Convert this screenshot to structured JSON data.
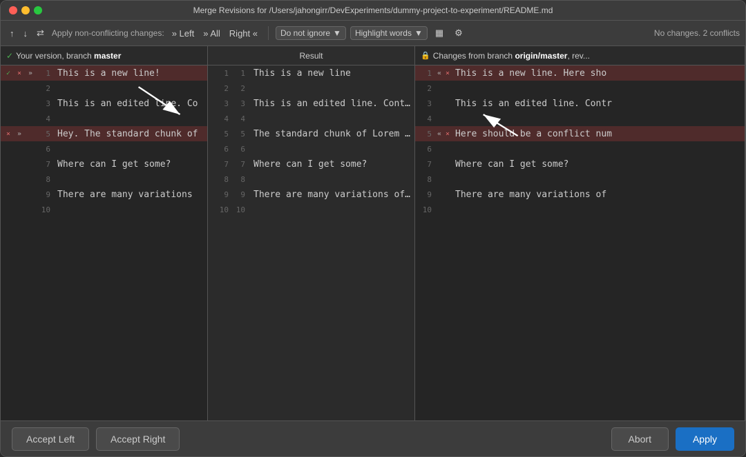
{
  "window": {
    "title": "Merge Revisions for /Users/jahongirr/DevExperiments/dummy-project-to-experiment/README.md"
  },
  "toolbar": {
    "up_icon": "↑",
    "down_icon": "↓",
    "merge_icon": "⇄",
    "apply_non_conflicting": "Apply non-conflicting changes:",
    "left_label": "» Left",
    "all_label": "» All",
    "right_label": "Right «",
    "ignore_dropdown": "Do not ignore",
    "highlight_dropdown": "Highlight words",
    "grid_icon": "▦",
    "settings_icon": "⚙",
    "status": "No changes. 2 conflicts"
  },
  "columns": {
    "left_header": "Your version, branch master",
    "middle_header": "Result",
    "right_header": "Changes from branch origin/master, rev..."
  },
  "left_panel": {
    "lines": [
      {
        "num": 1,
        "conflict": true,
        "accepted": true,
        "content": "This is a new line!",
        "controls": [
          "✓",
          "×",
          "»"
        ]
      },
      {
        "num": 2,
        "conflict": false,
        "accepted": false,
        "content": "",
        "controls": []
      },
      {
        "num": 3,
        "conflict": false,
        "accepted": false,
        "content": "This is an edited line. Co",
        "controls": []
      },
      {
        "num": 4,
        "conflict": false,
        "accepted": false,
        "content": "",
        "controls": []
      },
      {
        "num": 5,
        "conflict": true,
        "accepted": false,
        "content": "Hey. The standard chunk of",
        "controls": [
          "×",
          "»"
        ]
      },
      {
        "num": 6,
        "conflict": false,
        "accepted": false,
        "content": "",
        "controls": []
      },
      {
        "num": 7,
        "conflict": false,
        "accepted": false,
        "content": "Where can I get some?",
        "controls": []
      },
      {
        "num": 8,
        "conflict": false,
        "accepted": false,
        "content": "",
        "controls": []
      },
      {
        "num": 9,
        "conflict": false,
        "accepted": false,
        "content": "There are many variations",
        "controls": []
      },
      {
        "num": 10,
        "conflict": false,
        "accepted": false,
        "content": "",
        "controls": []
      }
    ]
  },
  "middle_panel": {
    "lines": [
      {
        "left_num": 1,
        "right_num": 1,
        "content": "This is a new line"
      },
      {
        "left_num": 2,
        "right_num": 2,
        "content": ""
      },
      {
        "left_num": 3,
        "right_num": 3,
        "content": "This is an edited line. Contra"
      },
      {
        "left_num": 4,
        "right_num": 4,
        "content": ""
      },
      {
        "left_num": 5,
        "right_num": 5,
        "content": "The standard chunk of Lorem Ip",
        "conflict": true
      },
      {
        "left_num": 6,
        "right_num": 6,
        "content": ""
      },
      {
        "left_num": 7,
        "right_num": 7,
        "content": "Where can I get some?"
      },
      {
        "left_num": 8,
        "right_num": 8,
        "content": ""
      },
      {
        "left_num": 9,
        "right_num": 9,
        "content": "There are many variations of p"
      },
      {
        "left_num": 10,
        "right_num": 10,
        "content": ""
      }
    ]
  },
  "right_panel": {
    "lines": [
      {
        "num": 1,
        "conflict": true,
        "content": "This is a new line. Here sho",
        "controls": [
          "«",
          "×"
        ]
      },
      {
        "num": 2,
        "conflict": false,
        "content": ""
      },
      {
        "num": 3,
        "conflict": false,
        "content": "This is an edited line. Contr"
      },
      {
        "num": 4,
        "conflict": false,
        "content": ""
      },
      {
        "num": 5,
        "conflict": true,
        "content": "Here should be a conflict num",
        "controls": [
          "«",
          "×"
        ]
      },
      {
        "num": 6,
        "conflict": false,
        "content": ""
      },
      {
        "num": 7,
        "conflict": false,
        "content": "Where can I get some?"
      },
      {
        "num": 8,
        "conflict": false,
        "content": ""
      },
      {
        "num": 9,
        "conflict": false,
        "content": "There are many variations of"
      },
      {
        "num": 10,
        "conflict": false,
        "content": ""
      }
    ]
  },
  "bottom_bar": {
    "accept_left": "Accept Left",
    "accept_right": "Accept Right",
    "abort": "Abort",
    "apply": "Apply"
  }
}
